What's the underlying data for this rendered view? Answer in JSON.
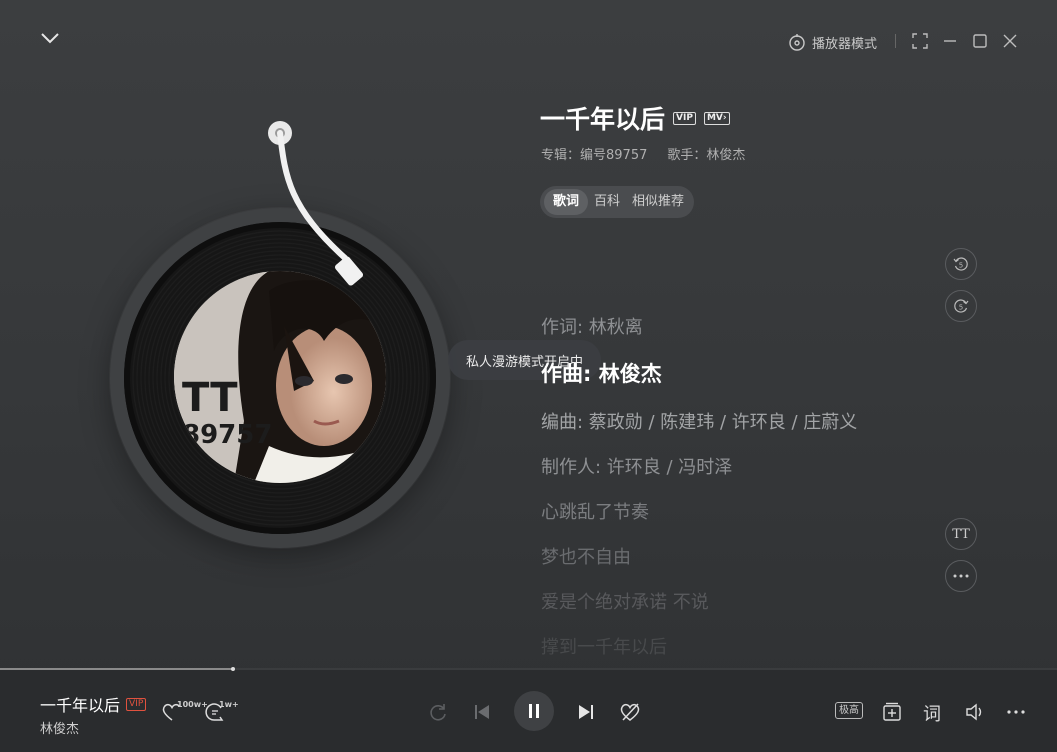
{
  "topbar": {
    "player_mode_label": "播放器模式"
  },
  "toast": "私人漫游模式开启中",
  "song": {
    "title": "一千年以后",
    "badge_vip": "VIP",
    "badge_mv": "MV",
    "album": "专辑：编号89757",
    "artist": "歌手：林俊杰"
  },
  "tabs": [
    "歌词",
    "百科",
    "相似推荐"
  ],
  "album_cover_text": "89757",
  "lyrics": [
    {
      "text": "作词: 林秋离",
      "active": false
    },
    {
      "text": "作曲: 林俊杰",
      "active": true
    },
    {
      "text": "编曲: 蔡政勋 / 陈建玮 / 许环良 / 庄蔚义",
      "active": false
    },
    {
      "text": "制作人: 许环良 / 冯时泽",
      "active": false
    },
    {
      "text": "心跳乱了节奏",
      "active": false
    },
    {
      "text": "梦也不自由",
      "active": false
    },
    {
      "text": "爱是个绝对承诺 不说",
      "active": false
    },
    {
      "text": "撑到一千年以后",
      "active": false
    }
  ],
  "side_controls": {
    "rewind_label": "5",
    "forward_label": "5",
    "font_label": "TT"
  },
  "bottom": {
    "title": "一千年以后",
    "vip": "VIP",
    "artist": "林俊杰",
    "like_count": "100w+",
    "comment_count": "1w+",
    "quality_label": "极高",
    "lyric_label": "词",
    "progress": 0.22
  },
  "colors": {
    "background": "#3a3c3e",
    "bottom_bar": "#2a2c2e",
    "vip_red": "#e0523f"
  }
}
